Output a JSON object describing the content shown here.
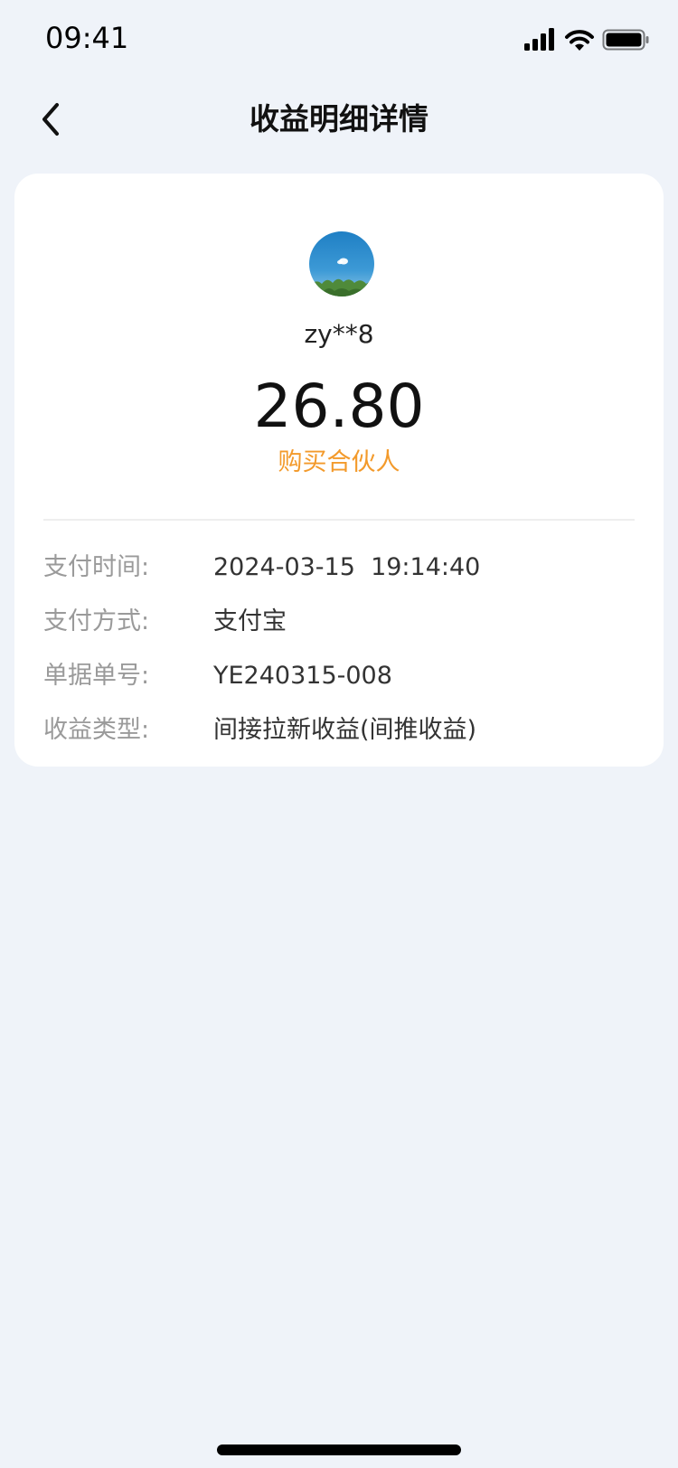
{
  "status_bar": {
    "time": "09:41",
    "icons": [
      "cellular-signal-icon",
      "wifi-icon",
      "battery-icon"
    ]
  },
  "nav": {
    "back_icon": "chevron-left-icon",
    "title": "收益明细详情"
  },
  "card": {
    "avatar": "user-avatar-sky-photo",
    "username": "zy**8",
    "amount": "26.80",
    "income_label": "购买合伙人",
    "details": [
      {
        "label": "支付时间:",
        "value": "2024-03-15  19:14:40"
      },
      {
        "label": "支付方式:",
        "value": "支付宝"
      },
      {
        "label": "单据单号:",
        "value": "YE240315-008"
      },
      {
        "label": "收益类型:",
        "value": "间接拉新收益(间推收益)"
      }
    ]
  },
  "colors": {
    "page_background": "#eff3f9",
    "card_background": "#ffffff",
    "accent_orange": "#f39a2b",
    "label_gray": "#9a9a9a"
  }
}
